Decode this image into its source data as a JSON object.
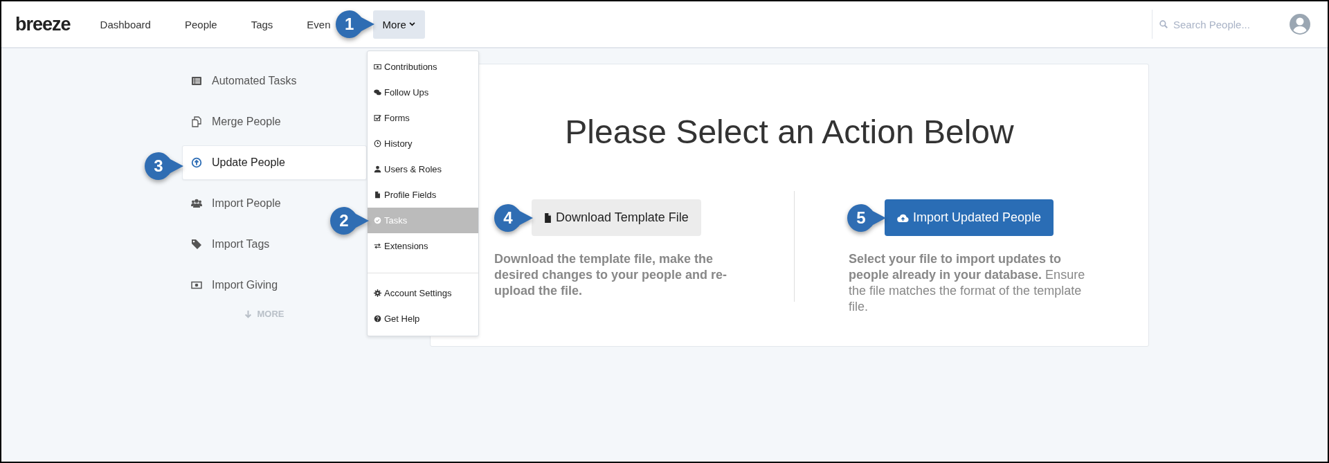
{
  "header": {
    "logo": "breeze",
    "nav": [
      {
        "label": "Dashboard",
        "kind": "link"
      },
      {
        "label": "People",
        "kind": "link"
      },
      {
        "label": "Tags",
        "kind": "link"
      },
      {
        "label": "Even",
        "kind": "link"
      },
      {
        "label": "More",
        "kind": "menu",
        "callout": "1"
      }
    ],
    "search": {
      "placeholder": "Search People..."
    }
  },
  "sidebar": {
    "items": [
      {
        "label": "Automated Tasks",
        "selected": false
      },
      {
        "label": "Merge People",
        "selected": false
      },
      {
        "label": "Update People",
        "selected": true,
        "callout": "3"
      },
      {
        "label": "Import People",
        "selected": false
      },
      {
        "label": "Import Tags",
        "selected": false
      },
      {
        "label": "Import Giving",
        "selected": false
      }
    ],
    "more": "MORE"
  },
  "dropdown": {
    "groups": [
      [
        {
          "label": "Contributions",
          "selected": false
        },
        {
          "label": "Follow Ups",
          "selected": false
        },
        {
          "label": "Forms",
          "selected": false
        },
        {
          "label": "History",
          "selected": false
        },
        {
          "label": "Users & Roles",
          "selected": false
        },
        {
          "label": "Profile Fields",
          "selected": false
        },
        {
          "label": "Tasks",
          "selected": true,
          "callout": "2"
        },
        {
          "label": "Extensions",
          "selected": false
        }
      ],
      [
        {
          "label": "Account Settings",
          "selected": false
        },
        {
          "label": "Get Help",
          "selected": false
        }
      ]
    ]
  },
  "main": {
    "title": "Please Select an Action Below",
    "actions": [
      {
        "button": "Download Template File",
        "kind": "secondary",
        "callout": "4",
        "description": "Download the template file, make the desired changes to your people and re-upload the file."
      },
      {
        "button": "Import Updated People",
        "kind": "primary",
        "callout": "5",
        "description": "**Select your file to import updates to people already in your database.** Ensure the file matches the format of the template file."
      }
    ]
  }
}
